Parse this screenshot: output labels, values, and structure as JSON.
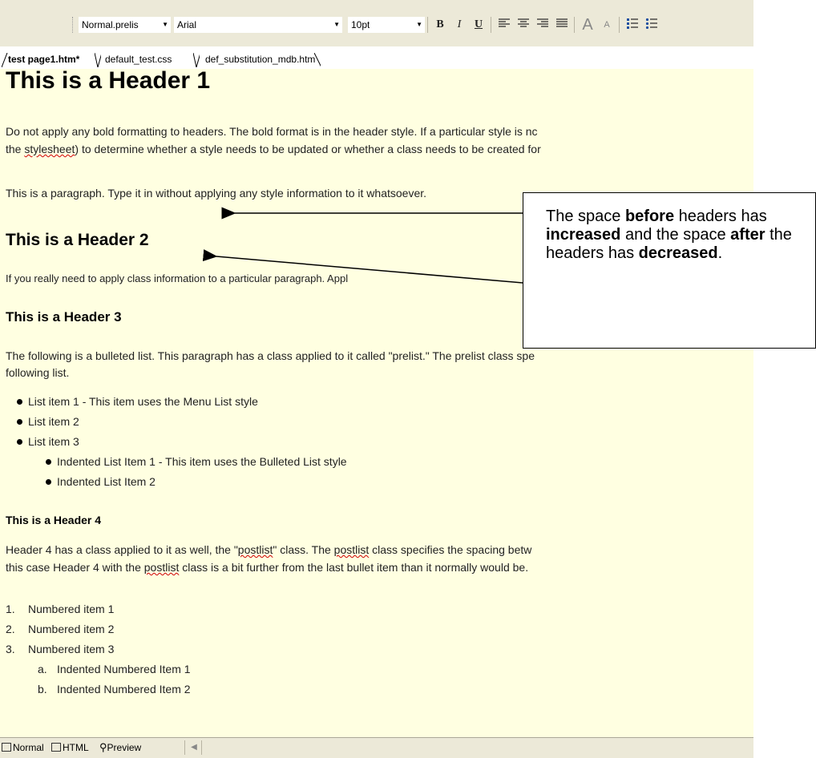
{
  "toolbar": {
    "style_value": "Normal.prelis",
    "font_value": "Arial",
    "size_value": "10pt",
    "bold_label": "B",
    "italic_label": "I",
    "underline_label": "U",
    "icons": [
      "align-left-icon",
      "align-center-icon",
      "align-right-icon",
      "justify-icon",
      "increase-font-icon",
      "decrease-font-icon",
      "numbered-list-icon",
      "bulleted-list-icon"
    ]
  },
  "tabs": [
    {
      "label": "test page1.htm*",
      "active": true
    },
    {
      "label": "default_test.css",
      "active": false
    },
    {
      "label": "def_substitution_mdb.htm",
      "active": false
    }
  ],
  "document": {
    "h1": "This is a Header 1",
    "p1_line1": "Do not apply any bold formatting to headers.  The bold format is in the header style.  If a particular style is nc",
    "p1_line2_a": "the ",
    "p1_line2_word": "stylesheet",
    "p1_line2_b": ") to determine whether a style needs to be updated or whether a class needs to be created for",
    "p2": "This is a paragraph.  Type it in without applying any style information to it whatsoever.",
    "h2": "This is a Header 2",
    "p3": "If you really need to apply class information to a particular paragraph. Appl",
    "h3": "This is a Header 3",
    "p4_line1": "The following is a bulleted list.  This paragraph has a class applied to it called \"prelist.\"  The prelist class spe",
    "p4_line2": "following list.",
    "bullets": [
      "List item 1 - This item uses the Menu List style",
      "List item 2",
      "List item 3"
    ],
    "sub_bullets": [
      "Indented List Item 1 - This item uses the Bulleted List style",
      "Indented List Item 2"
    ],
    "h4": "This is a Header 4",
    "p5_line1_a": "Header 4 has a class applied to it as well, the \"",
    "p5_line1_word1": "postlist",
    "p5_line1_b": "\" class.  The ",
    "p5_line1_word2": "postlist",
    "p5_line1_c": " class specifies the spacing betw",
    "p5_line2_a": "this case Header 4 with the ",
    "p5_line2_word": "postlist",
    "p5_line2_b": " class is a bit further from the last bullet item than it normally would be.",
    "numbered": [
      {
        "marker": "1.",
        "text": "Numbered item 1"
      },
      {
        "marker": "2.",
        "text": "Numbered item 2"
      },
      {
        "marker": "3.",
        "text": "Numbered item 3"
      }
    ],
    "sub_numbered": [
      {
        "marker": "a.",
        "text": "Indented Numbered Item 1"
      },
      {
        "marker": "b.",
        "text": "Indented Numbered Item 2"
      }
    ]
  },
  "callout": {
    "t1": "The space ",
    "t2": "before",
    "t3": " headers has ",
    "t4": "increased",
    "t5": " and the space ",
    "t6": "after",
    "t7": " the headers has ",
    "t8": "decreased",
    "t9": "."
  },
  "view_tabs": [
    "Normal",
    "HTML",
    "Preview"
  ],
  "colors": {
    "document_bg": "#ffffe1",
    "chrome": "#ece9d8"
  }
}
